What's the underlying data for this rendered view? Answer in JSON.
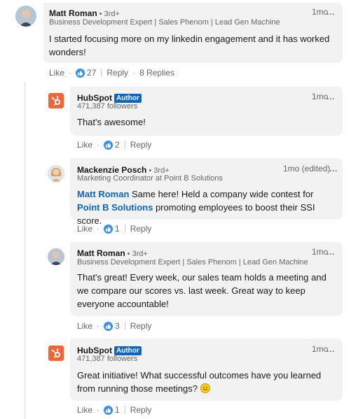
{
  "comments": [
    {
      "author": "Matt Roman",
      "degree": "• 3rd+",
      "headline": "Business Development Expert | Sales Phenom | Lead Gen Machine",
      "time": "1mo",
      "more": "...",
      "text": "I started focusing more on my linkedin engagement and it has worked wonders!",
      "like_label": "Like",
      "dot": "·",
      "like_count": "27",
      "reply_label": "Reply",
      "replies_label": "8 Replies"
    }
  ],
  "replies": [
    {
      "author": "HubSpot",
      "badge": "Author",
      "headline": "471,387 followers",
      "time": "1mo",
      "more": "...",
      "text": "That's awesome!",
      "like_label": "Like",
      "dot": "·",
      "like_count": "2",
      "reply_label": "Reply"
    },
    {
      "author": "Mackenzie Posch",
      "degree": "• 3rd+",
      "headline": "Marketing Coordinator at Point B Solutions",
      "time": "1mo (edited)",
      "more": "...",
      "mention": "Matt Roman",
      "text_a": " Same here! Held a company wide contest for ",
      "mention2": "Point B Solutions",
      "text_b": " promoting employees to boost their SSI score.",
      "like_label": "Like",
      "dot": "·",
      "like_count": "1",
      "reply_label": "Reply"
    },
    {
      "author": "Matt Roman",
      "degree": "• 3rd+",
      "headline": "Business Development Expert | Sales Phenom | Lead Gen Machine",
      "time": "1mo",
      "more": "...",
      "text": "That's great! Every week, our sales team holds a meeting and we compare our scores vs. last week. Great way to keep everyone accountable!",
      "like_label": "Like",
      "dot": "·",
      "like_count": "3",
      "reply_label": "Reply"
    },
    {
      "author": "HubSpot",
      "badge": "Author",
      "headline": "471,387 followers",
      "time": "1mo",
      "more": "...",
      "text": "Great initiative! What successful outcomes have you learned from running those meetings? ",
      "like_label": "Like",
      "dot": "·",
      "like_count": "1",
      "reply_label": "Reply"
    }
  ],
  "colors": {
    "link": "#0a66c2",
    "hubspot": "#f26538",
    "like": "#378fe9",
    "bubble": "#f2f2f2"
  }
}
